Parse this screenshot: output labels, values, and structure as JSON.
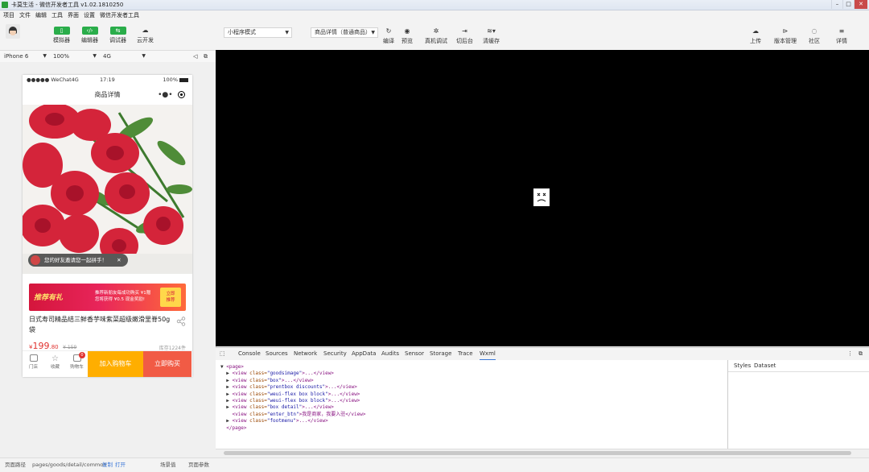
{
  "window": {
    "title": "卡莫生活 - 微信开发者工具 v1.02.1810250"
  },
  "menu": [
    "项目",
    "文件",
    "编辑",
    "工具",
    "界面",
    "设置",
    "微信开发者工具"
  ],
  "toolbar": {
    "simulator": "模拟器",
    "editor": "编辑器",
    "debugger": "调试器",
    "cloud": "云开发",
    "mode_select": "小程序模式",
    "compile_select": "商品详情（普通商品）",
    "compile": "编译",
    "preview": "预览",
    "remote_debug": "真机调试",
    "background": "切后台",
    "clear_cache": "清缓存",
    "upload": "上传",
    "version": "版本管理",
    "community": "社区",
    "details": "详情"
  },
  "device": {
    "model": "iPhone 6",
    "zoom": "100%",
    "network": "4G"
  },
  "phone": {
    "carrier": "●●●●● WeChat4G",
    "time": "17:19",
    "battery": "100%",
    "nav_title": "商品详情",
    "capsule_dots": "•●•",
    "toast": "您的好友邀请您一起拼手！",
    "toast_close": "✕",
    "banner_title": "推荐有礼",
    "banner_line1": "推荐新朋友每成功购买 ¥1赠",
    "banner_line2": "您将获得 ¥0.5 现金奖励!",
    "banner_btn1": "立即",
    "banner_btn2": "推荐",
    "product_title": "日式寿司精品结三鲜香芋味紫菜超级嫩滑里脊50g袋",
    "price_symbol": "¥",
    "price_int": "199",
    "price_dec": ".80",
    "old_price": "¥ 159",
    "stock": "库存1224件",
    "footer": {
      "store": "门店",
      "favorite": "收藏",
      "cart": "购物车",
      "cart_badge": "0",
      "add_to_cart": "加入购物车",
      "buy_now": "立即购买"
    }
  },
  "devtools": {
    "tabs": [
      "Console",
      "Sources",
      "Network",
      "Security",
      "AppData",
      "Audits",
      "Sensor",
      "Storage",
      "Trace",
      "Wxml"
    ],
    "active_tab": "Wxml",
    "wxml_lines": [
      {
        "pre": "▼ ",
        "tag": "<page>",
        "cls": "",
        "after": ""
      },
      {
        "pre": "  ▶ ",
        "tag": "<view ",
        "cls": "\"goodsimage\"",
        "after": ">...</view>"
      },
      {
        "pre": "  ▶ ",
        "tag": "<view ",
        "cls": "\"box\"",
        "after": ">...</view>"
      },
      {
        "pre": "  ▶ ",
        "tag": "<view ",
        "cls": "\"prentbox discounts\"",
        "after": ">...</view>"
      },
      {
        "pre": "  ▶ ",
        "tag": "<view ",
        "cls": "\"weui-flex box block\"",
        "after": ">...</view>"
      },
      {
        "pre": "  ▶ ",
        "tag": "<view ",
        "cls": "\"weui-flex box block\"",
        "after": ">...</view>"
      },
      {
        "pre": "  ▶ ",
        "tag": "<view ",
        "cls": "\"box detail\"",
        "after": ">...</view>"
      },
      {
        "pre": "    ",
        "tag": "<view ",
        "cls": "\"enter_btn\"",
        "after": ">我是商家，我要入驻</view>"
      },
      {
        "pre": "  ▶ ",
        "tag": "<view ",
        "cls": "\"footmenu\"",
        "after": ">...</view>"
      },
      {
        "pre": "  ",
        "tag": "</page>",
        "cls": "",
        "after": ""
      }
    ],
    "styles_tab": "Styles",
    "dataset_tab": "Dataset"
  },
  "statusbar": {
    "path_label": "页面路径",
    "path": "pages/goods/detail/common",
    "copy": "复制",
    "open": "打开",
    "scene": "场景值",
    "params": "页面参数"
  }
}
